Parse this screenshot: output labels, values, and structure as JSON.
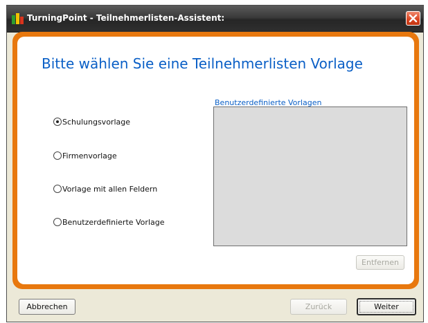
{
  "window": {
    "title": "TurningPoint - Teilnehmerlisten-Assistent:"
  },
  "main": {
    "heading": "Bitte wählen Sie eine Teilnehmerlisten Vorlage",
    "options": [
      {
        "label": "Schulungsvorlage",
        "selected": true
      },
      {
        "label": "Firmenvorlage",
        "selected": false
      },
      {
        "label": "Vorlage mit allen Feldern",
        "selected": false
      },
      {
        "label": "Benutzerdefinierte Vorlage",
        "selected": false
      }
    ],
    "custom_list_label": "Benutzerdefinierte Vorlagen",
    "remove_button": "Entfernen"
  },
  "footer": {
    "cancel": "Abbrechen",
    "back": "Zurück",
    "next": "Weiter"
  },
  "colors": {
    "accent_orange": "#e8780e",
    "heading_blue": "#0a5fc6",
    "close_red": "#d9431f"
  },
  "icons": {
    "app": "turningpoint-app-icon",
    "close": "close-icon"
  }
}
